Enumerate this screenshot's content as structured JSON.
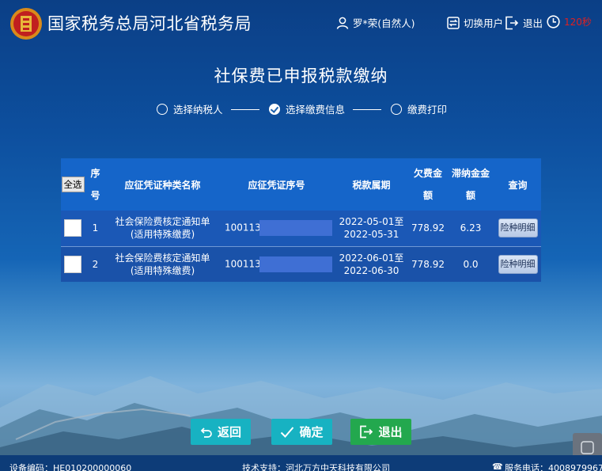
{
  "header": {
    "org_name": "国家税务总局河北省税务局",
    "user_name": "罗*荣(自然人)",
    "switch_user": "切换用户",
    "logout": "退出",
    "countdown": "120秒"
  },
  "page": {
    "title": "社保费已申报税款缴纳"
  },
  "steps": [
    {
      "label": "选择纳税人",
      "state": "pending"
    },
    {
      "label": "选择缴费信息",
      "state": "done"
    },
    {
      "label": "缴费打印",
      "state": "pending"
    }
  ],
  "table": {
    "select_all": "全选",
    "headers": {
      "seq_1": "序",
      "seq_2": "号",
      "type": "应征凭证种类名称",
      "voucher_no": "应征凭证序号",
      "period": "税款属期",
      "owed_1": "欠费金",
      "owed_2": "额",
      "late_1": "滞纳金金",
      "late_2": "额",
      "query": "查询"
    },
    "rows": [
      {
        "seq": "1",
        "type_1": "社会保险费核定通知单",
        "type_2": "(适用特殊缴费)",
        "voucher_prefix": "100113",
        "period_1": "2022-05-01至",
        "period_2": "2022-05-31",
        "owed": "778.92",
        "late_fee": "6.23",
        "detail": "险种明细"
      },
      {
        "seq": "2",
        "type_1": "社会保险费核定通知单",
        "type_2": "(适用特殊缴费)",
        "voucher_prefix": "100113",
        "period_1": "2022-06-01至",
        "period_2": "2022-06-30",
        "owed": "778.92",
        "late_fee": "0.0",
        "detail": "险种明细"
      }
    ]
  },
  "buttons": {
    "back": "返回",
    "confirm": "确定",
    "exit": "退出"
  },
  "footer": {
    "device": "设备编码：HE010200000060",
    "support": "技术支持：河北万方中天科技有限公司",
    "hotline": "服务电话：4008979967"
  },
  "colors": {
    "accent_teal": "#17b2c2",
    "exit_green": "#23a84e",
    "countdown_red": "#e02020",
    "table_header": "#1565c9"
  }
}
